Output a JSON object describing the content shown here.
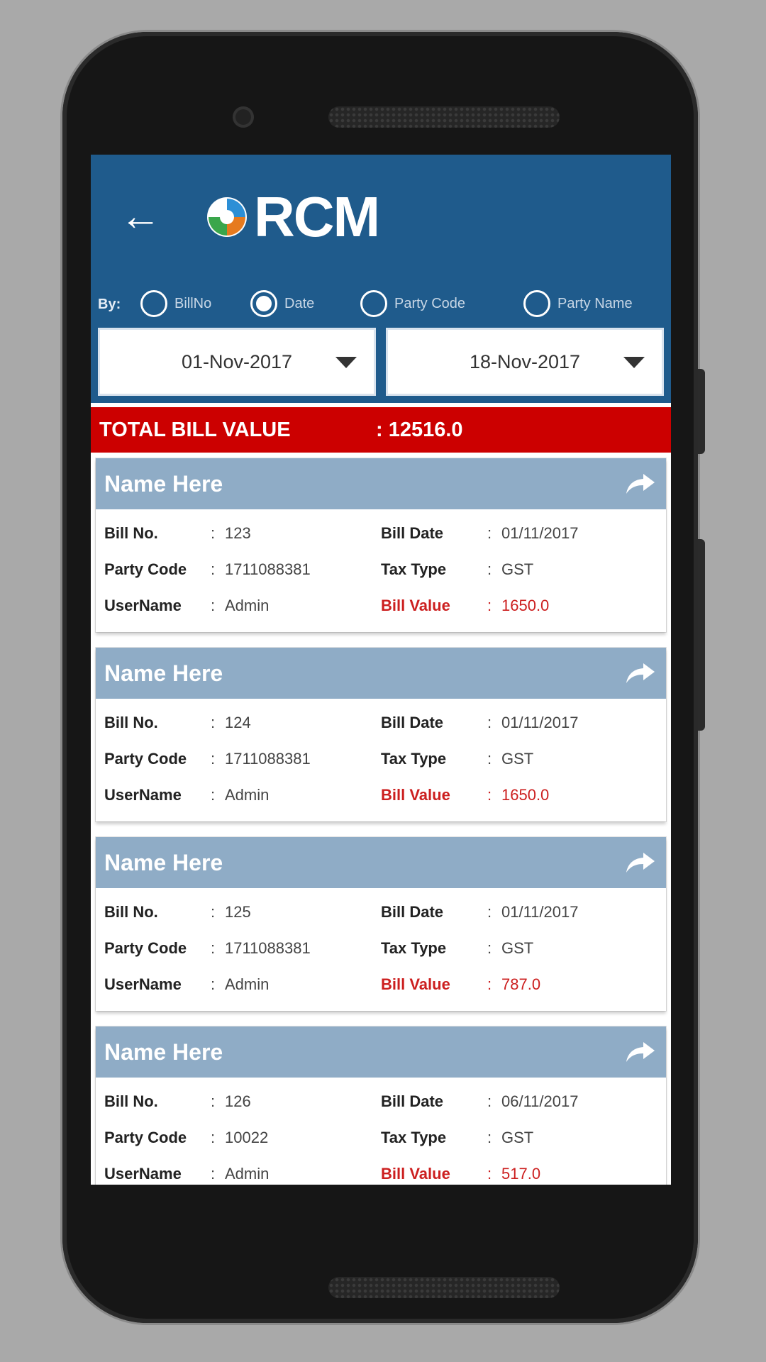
{
  "app": {
    "logo_text": "RCM"
  },
  "filter": {
    "by_label": "By:",
    "options": [
      {
        "label": "BillNo",
        "checked": false
      },
      {
        "label": "Date",
        "checked": true
      },
      {
        "label": "Party Code",
        "checked": false
      },
      {
        "label": "Party Name",
        "checked": false
      }
    ],
    "from_date": "01-Nov-2017",
    "to_date": "18-Nov-2017"
  },
  "total": {
    "label": "TOTAL BILL VALUE",
    "value": ": 12516.0"
  },
  "field_labels": {
    "bill_no": "Bill No.",
    "bill_date": "Bill Date",
    "party_code": "Party Code",
    "tax_type": "Tax Type",
    "username": "UserName",
    "bill_value": "Bill Value",
    "sep": ":"
  },
  "bills": [
    {
      "name": "Name Here",
      "bill_no": "123",
      "bill_date": "01/11/2017",
      "party_code": "1711088381",
      "tax_type": "GST",
      "username": "Admin",
      "bill_value": "1650.0"
    },
    {
      "name": "Name Here",
      "bill_no": "124",
      "bill_date": "01/11/2017",
      "party_code": "1711088381",
      "tax_type": "GST",
      "username": "Admin",
      "bill_value": "1650.0"
    },
    {
      "name": "Name Here",
      "bill_no": "125",
      "bill_date": "01/11/2017",
      "party_code": "1711088381",
      "tax_type": "GST",
      "username": "Admin",
      "bill_value": "787.0"
    },
    {
      "name": "Name Here",
      "bill_no": "126",
      "bill_date": "06/11/2017",
      "party_code": "10022",
      "tax_type": "GST",
      "username": "Admin",
      "bill_value": "517.0"
    }
  ],
  "colors": {
    "header": "#1f5b8c",
    "total_bar": "#cc0000",
    "card_header": "#8facc6",
    "bill_value": "#cc1f1f"
  }
}
